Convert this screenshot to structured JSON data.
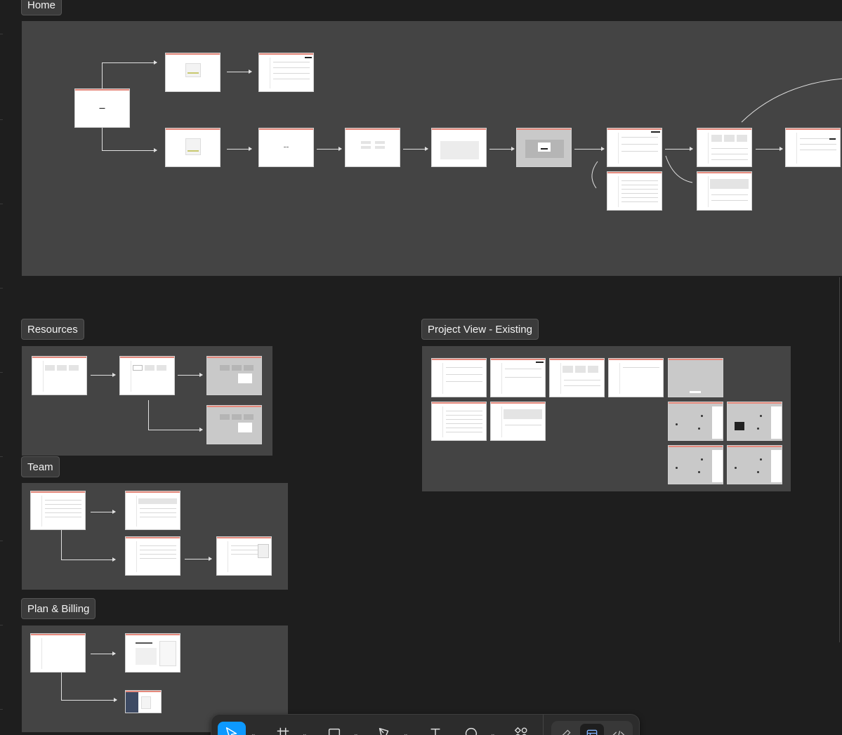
{
  "sections": {
    "home": {
      "title": "Home"
    },
    "resources": {
      "title": "Resources"
    },
    "project_view": {
      "title": "Project View - Existing"
    },
    "team": {
      "title": "Team"
    },
    "plan_billing": {
      "title": "Plan & Billing"
    }
  },
  "toolbar": {
    "tools": [
      {
        "icon": "move-pointer-icon",
        "active": true
      },
      {
        "icon": "frame-hash-icon",
        "active": false
      },
      {
        "icon": "rectangle-icon",
        "active": false
      },
      {
        "icon": "pen-icon",
        "active": false
      },
      {
        "icon": "text-icon",
        "active": false
      },
      {
        "icon": "comment-icon",
        "active": false
      },
      {
        "icon": "actions-icon",
        "active": false
      }
    ],
    "modes": [
      {
        "icon": "draw-mode-icon",
        "active": false
      },
      {
        "icon": "design-mode-icon",
        "active": true
      },
      {
        "icon": "dev-mode-icon",
        "active": false
      }
    ]
  },
  "colors": {
    "canvas": "#1e1e1e",
    "section_bg": "#444444",
    "frame_accent": "#e5897c",
    "active_tool": "#0d99ff"
  }
}
